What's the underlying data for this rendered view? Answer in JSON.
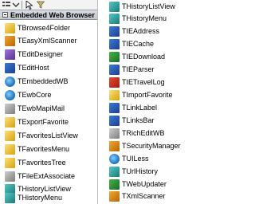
{
  "category": {
    "title": "Embedded Web Browser"
  },
  "left_items": [
    {
      "label": "TBrowse4Folder",
      "icon": "folder-icon"
    },
    {
      "label": "TEasyXmlScanner",
      "icon": "xml-icon"
    },
    {
      "label": "TEditDesigner",
      "icon": "designer-icon"
    },
    {
      "label": "TEditHost",
      "icon": "host-icon"
    },
    {
      "label": "TEmbeddedWB",
      "icon": "globe-icon"
    },
    {
      "label": "TEwbCore",
      "icon": "globe-icon"
    },
    {
      "label": "TEwbMapiMail",
      "icon": "mail-icon"
    },
    {
      "label": "TExportFavorite",
      "icon": "favorite-icon"
    },
    {
      "label": "TFavoritesListView",
      "icon": "favorite-icon"
    },
    {
      "label": "TFavoritesMenu",
      "icon": "favorite-icon"
    },
    {
      "label": "TFavoritesTree",
      "icon": "favorite-icon"
    },
    {
      "label": "TFileExtAssociate",
      "icon": "file-icon"
    },
    {
      "label": "THistoryListView",
      "icon": "history-icon"
    },
    {
      "label": "THistoryMenu",
      "icon": "history-icon"
    }
  ],
  "right_items": [
    {
      "label": "THistoryListView",
      "icon": "history-icon"
    },
    {
      "label": "THistoryMenu",
      "icon": "history-icon"
    },
    {
      "label": "TIEAddress",
      "icon": "address-icon"
    },
    {
      "label": "TIECache",
      "icon": "cache-icon"
    },
    {
      "label": "TIEDownload",
      "icon": "download-icon"
    },
    {
      "label": "TIEParser",
      "icon": "parser-icon"
    },
    {
      "label": "TIETravelLog",
      "icon": "travel-log-icon"
    },
    {
      "label": "TImportFavorite",
      "icon": "favorite-icon"
    },
    {
      "label": "TLinkLabel",
      "icon": "link-icon"
    },
    {
      "label": "TLinksBar",
      "icon": "links-bar-icon"
    },
    {
      "label": "TRichEditWB",
      "icon": "rich-edit-icon"
    },
    {
      "label": "TSecurityManager",
      "icon": "security-icon"
    },
    {
      "label": "TUILess",
      "icon": "globe-icon"
    },
    {
      "label": "TUrlHistory",
      "icon": "history-icon"
    },
    {
      "label": "TWebUpdater",
      "icon": "updater-icon"
    },
    {
      "label": "TXmlScanner",
      "icon": "xml-icon"
    }
  ]
}
